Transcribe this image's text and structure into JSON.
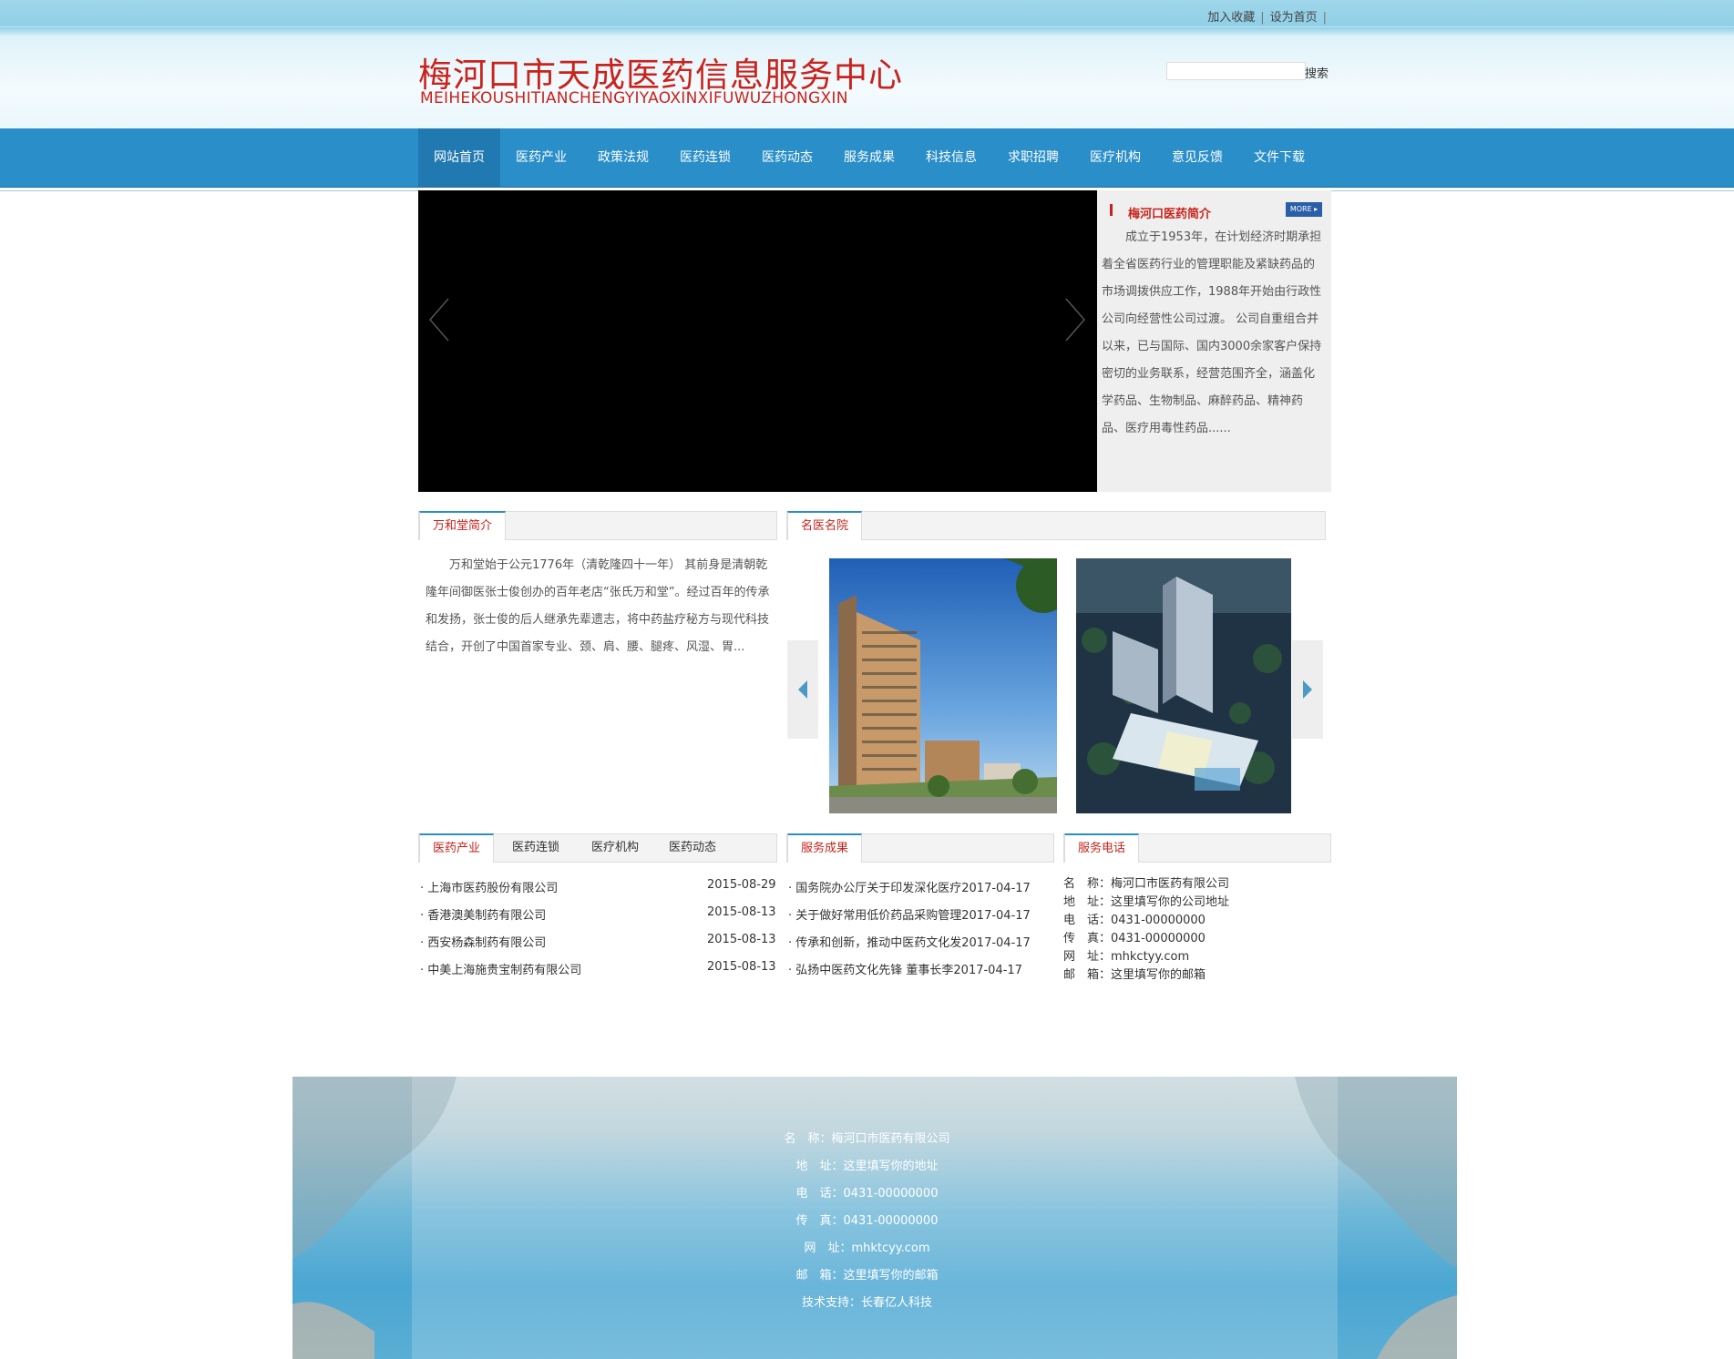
{
  "top_links": [
    "加入收藏",
    "设为首页"
  ],
  "site": {
    "title": "梅河口市天成医药信息服务中心",
    "subtitle": "MEIHEKOUSHITIANCHENGYIYAOXINXIFUWUZHONGXIN"
  },
  "search": {
    "button": "搜索",
    "placeholder": ""
  },
  "nav": [
    "网站首页",
    "医药产业",
    "政策法规",
    "医药连锁",
    "医药动态",
    "服务成果",
    "科技信息",
    "求职招聘",
    "医疗机构",
    "意见反馈",
    "文件下载"
  ],
  "intro": {
    "title": "梅河口医药简介",
    "more": "MORE ▸",
    "text": "成立于1953年，在计划经济时期承担着全省医药行业的管理职能及紧缺药品的市场调拨供应工作，1988年开始由行政性公司向经营性公司过渡。 公司自重组合并以来，已与国际、国内3000余家客户保持密切的业务联系，经营范围齐全，涵盖化学药品、生物制品、麻醉药品、精神药品、医疗用毒性药品......"
  },
  "wanhetang": {
    "tab": "万和堂简介",
    "text": "万和堂始于公元1776年（清乾隆四十一年） 其前身是清朝乾隆年间御医张士俊创办的百年老店“张氏万和堂”。经过百年的传承和发扬，张士俊的后人继承先辈遗志，将中药盐疗秘方与现代科技结合，开创了中国首家专业、颈、肩、腰、腿疼、风湿、胃..."
  },
  "hospitals": {
    "tab": "名医名院"
  },
  "industry": {
    "tabs": [
      "医药产业",
      "医药连锁",
      "医疗机构",
      "医药动态"
    ],
    "items": [
      {
        "title": "· 上海市医药股份有限公司",
        "date": "2015-08-29"
      },
      {
        "title": "· 香港澳美制药有限公司",
        "date": "2015-08-13"
      },
      {
        "title": "· 西安杨森制药有限公司",
        "date": "2015-08-13"
      },
      {
        "title": "· 中美上海施贵宝制药有限公司",
        "date": "2015-08-13"
      }
    ]
  },
  "results": {
    "tab": "服务成果",
    "items": [
      {
        "title": "· 国务院办公厅关于印发深化医疗",
        "date": "2017-04-17"
      },
      {
        "title": "· 关于做好常用低价药品采购管理",
        "date": "2017-04-17"
      },
      {
        "title": "· 传承和创新，推动中医药文化发",
        "date": "2017-04-17"
      },
      {
        "title": "· 弘扬中医药文化先锋 董事长李",
        "date": "2017-04-17"
      }
    ]
  },
  "phone": {
    "tab": "服务电话",
    "lines": [
      "名　称：梅河口市医药有限公司",
      "地　址：这里填写你的公司地址",
      "电　话：0431-00000000",
      "传　真：0431-00000000",
      "网　址：mhkctyy.com",
      "邮　箱：这里填写你的邮箱"
    ]
  },
  "footer": {
    "lines": [
      "名　称：梅河口市医药有限公司",
      "地　址：这里填写你的地址",
      "电　话：0431-00000000",
      "传　真：0431-00000000",
      "网　址：mhktcyy.com",
      "邮　箱：这里填写你的邮箱",
      "技术支持：长春亿人科技"
    ]
  },
  "colors": {
    "brand_red": "#c8231c",
    "nav_blue": "#2a8ec8",
    "nav_active": "#2079b1"
  }
}
